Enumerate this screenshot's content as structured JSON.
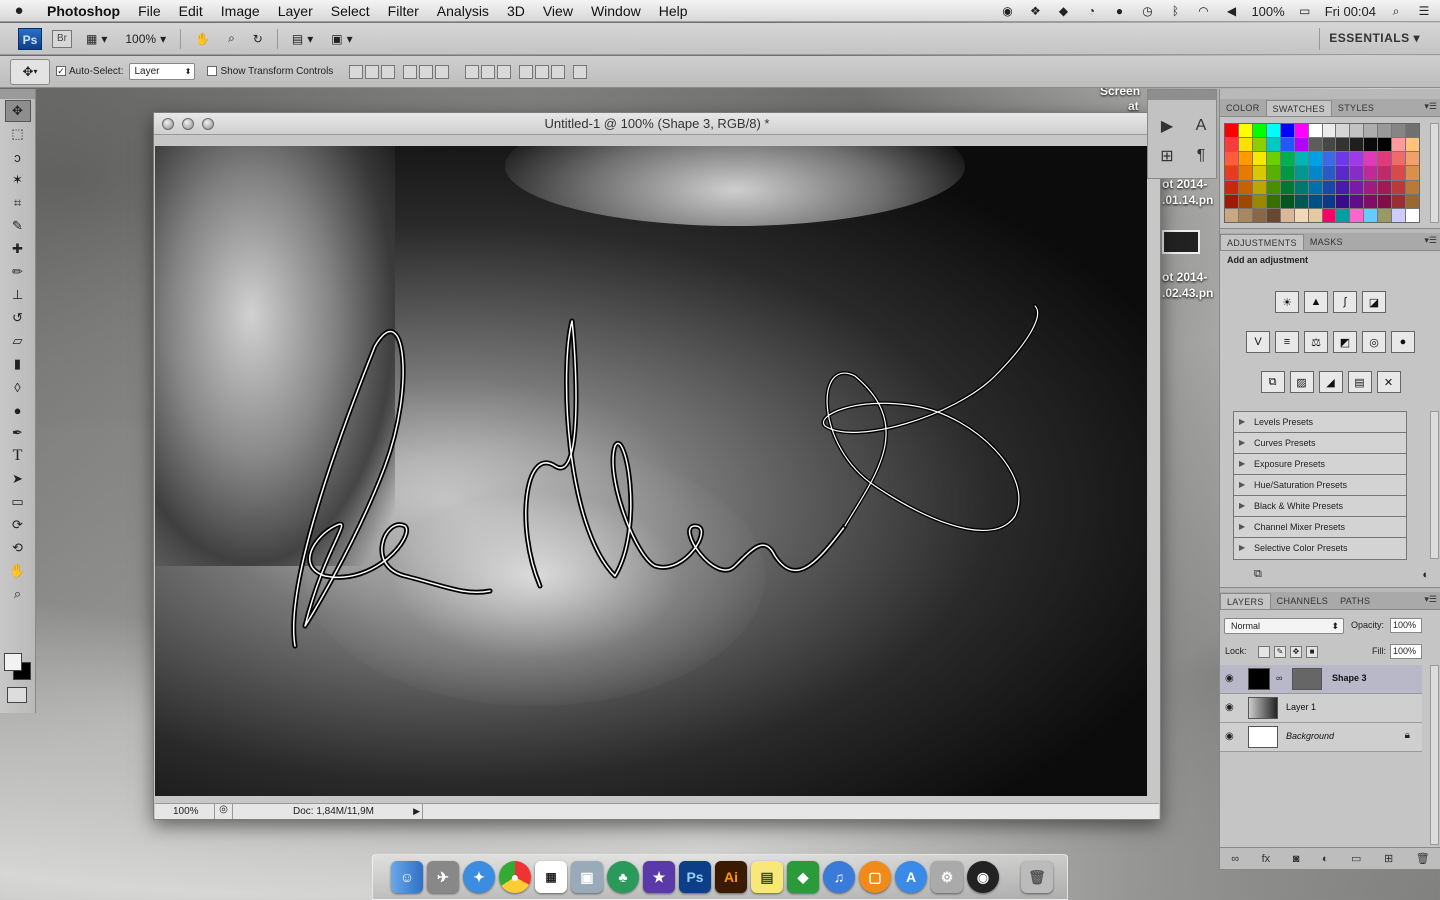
{
  "menubar": {
    "apple_glyph": "",
    "items": [
      "Photoshop",
      "File",
      "Edit",
      "Image",
      "Layer",
      "Select",
      "Filter",
      "Analysis",
      "3D",
      "View",
      "Window",
      "Help"
    ],
    "battery": "100%",
    "clock": "Fri 00:04"
  },
  "appbar": {
    "ps_label": "Ps",
    "br_label": "Br",
    "zoom": "100%",
    "workspace": "ESSENTIALS ▾"
  },
  "options": {
    "auto_select_label": "Auto-Select:",
    "auto_select_value": "Layer",
    "transform_label": "Show Transform Controls"
  },
  "document": {
    "title": "Untitled-1 @ 100% (Shape 3, RGB/8) *",
    "zoom": "100%",
    "doc_info": "Doc: 1,84M/11,9M"
  },
  "desktop": {
    "labels": [
      "Screen",
      "at",
      "ot 2014-",
      ".01.14.pn",
      "ot 2014-",
      ".02.43.pn"
    ]
  },
  "color_panel": {
    "tabs": [
      "COLOR",
      "SWATCHES",
      "STYLES"
    ],
    "active": "SWATCHES",
    "swatch_colors": [
      "#ff0000",
      "#ffff00",
      "#00ff00",
      "#00ffff",
      "#0000ff",
      "#ff00ff",
      "#ffffff",
      "#ebebeb",
      "#d6d6d6",
      "#c2c2c2",
      "#adadad",
      "#999999",
      "#858585",
      "#707070",
      "#ff3b3b",
      "#ffe000",
      "#8ad000",
      "#00c8c8",
      "#1e5aff",
      "#b400ff",
      "#5c5c5c",
      "#474747",
      "#333333",
      "#1f1f1f",
      "#0a0a0a",
      "#000000",
      "#ff9a9a",
      "#ffc27a",
      "#ff5c3b",
      "#ff9a00",
      "#f6e800",
      "#6cd000",
      "#00b050",
      "#00b8b0",
      "#00a0e8",
      "#3a6ae8",
      "#6a3ae8",
      "#a03ae8",
      "#e03ab8",
      "#e03a7a",
      "#f06a6a",
      "#f0a06a",
      "#e83a1e",
      "#e87a00",
      "#d8c800",
      "#58b000",
      "#009840",
      "#009890",
      "#0088c8",
      "#2a5ac8",
      "#5a2ac8",
      "#8a2ac8",
      "#c02a98",
      "#c02a6a",
      "#d84a4a",
      "#d8904a",
      "#c82810",
      "#c86200",
      "#b8a800",
      "#489000",
      "#007830",
      "#007870",
      "#0070a8",
      "#1a48a8",
      "#4a1aa8",
      "#7a1aa8",
      "#a01a80",
      "#a01a58",
      "#b83a3a",
      "#b87a3a",
      "#a01808",
      "#a04800",
      "#988800",
      "#387000",
      "#005820",
      "#005850",
      "#005088",
      "#0e3888",
      "#380e88",
      "#600e88",
      "#800e68",
      "#800e48",
      "#983030",
      "#986a30",
      "#c8a880",
      "#a88860",
      "#886848",
      "#684830",
      "#d8b898",
      "#f0d8b8",
      "#e8c8a0",
      "#ff0066",
      "#00a0a0",
      "#ff66cc",
      "#66ccff",
      "#999966",
      "#ccccff",
      "#ffffff"
    ]
  },
  "adjustments": {
    "tabs": [
      "ADJUSTMENTS",
      "MASKS"
    ],
    "heading": "Add an adjustment",
    "presets": [
      "Levels Presets",
      "Curves Presets",
      "Exposure Presets",
      "Hue/Saturation Presets",
      "Black & White Presets",
      "Channel Mixer Presets",
      "Selective Color Presets"
    ]
  },
  "layers": {
    "tabs": [
      "LAYERS",
      "CHANNELS",
      "PATHS"
    ],
    "blend_mode": "Normal",
    "opacity_label": "Opacity:",
    "opacity": "100%",
    "lock_label": "Lock:",
    "fill_label": "Fill:",
    "fill": "100%",
    "items": [
      {
        "name": "Shape 3",
        "selected": true
      },
      {
        "name": "Layer 1",
        "selected": false
      },
      {
        "name": "Background",
        "selected": false
      }
    ]
  }
}
